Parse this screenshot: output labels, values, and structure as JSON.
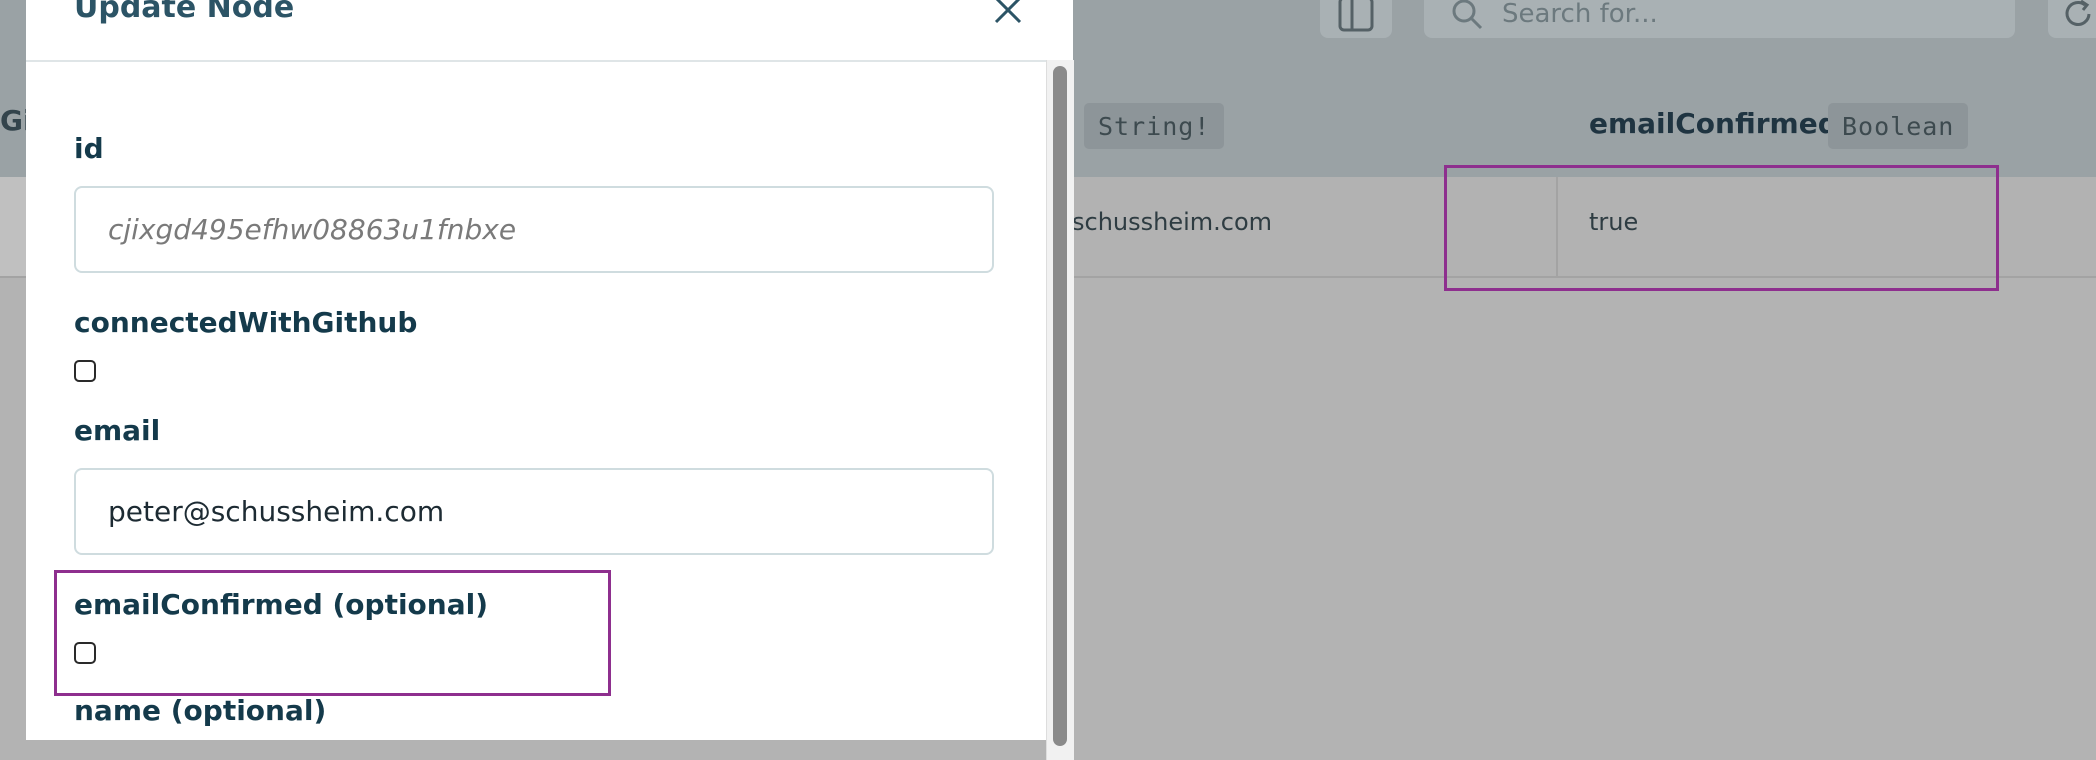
{
  "modal": {
    "title": "Update Node",
    "fields": {
      "id": {
        "label": "id",
        "value": "cjixgd495efhw08863u1fnbxe"
      },
      "connected_with_github": {
        "label": "connectedWithGithub",
        "checked": false
      },
      "email": {
        "label": "email",
        "value": "peter@schussheim.com"
      },
      "email_confirmed": {
        "label": "emailConfirmed (optional)",
        "checked": false
      },
      "name": {
        "label": "name (optional)"
      }
    }
  },
  "toolbar": {
    "search_placeholder": "Search for...",
    "icons": [
      "layout-icon",
      "search-icon",
      "refresh-icon"
    ]
  },
  "table": {
    "partial_column_label": "Gi",
    "columns": [
      {
        "title": "",
        "type": "String!"
      },
      {
        "title": "emailConfirmed",
        "type": "Boolean"
      }
    ],
    "row": {
      "email_partial": "schussheim.com",
      "email_confirmed": "true"
    }
  },
  "colors": {
    "highlight": "#8e2f8e",
    "label": "#143a4b",
    "title": "#2c5466",
    "overlay": "#b3b3b3"
  }
}
